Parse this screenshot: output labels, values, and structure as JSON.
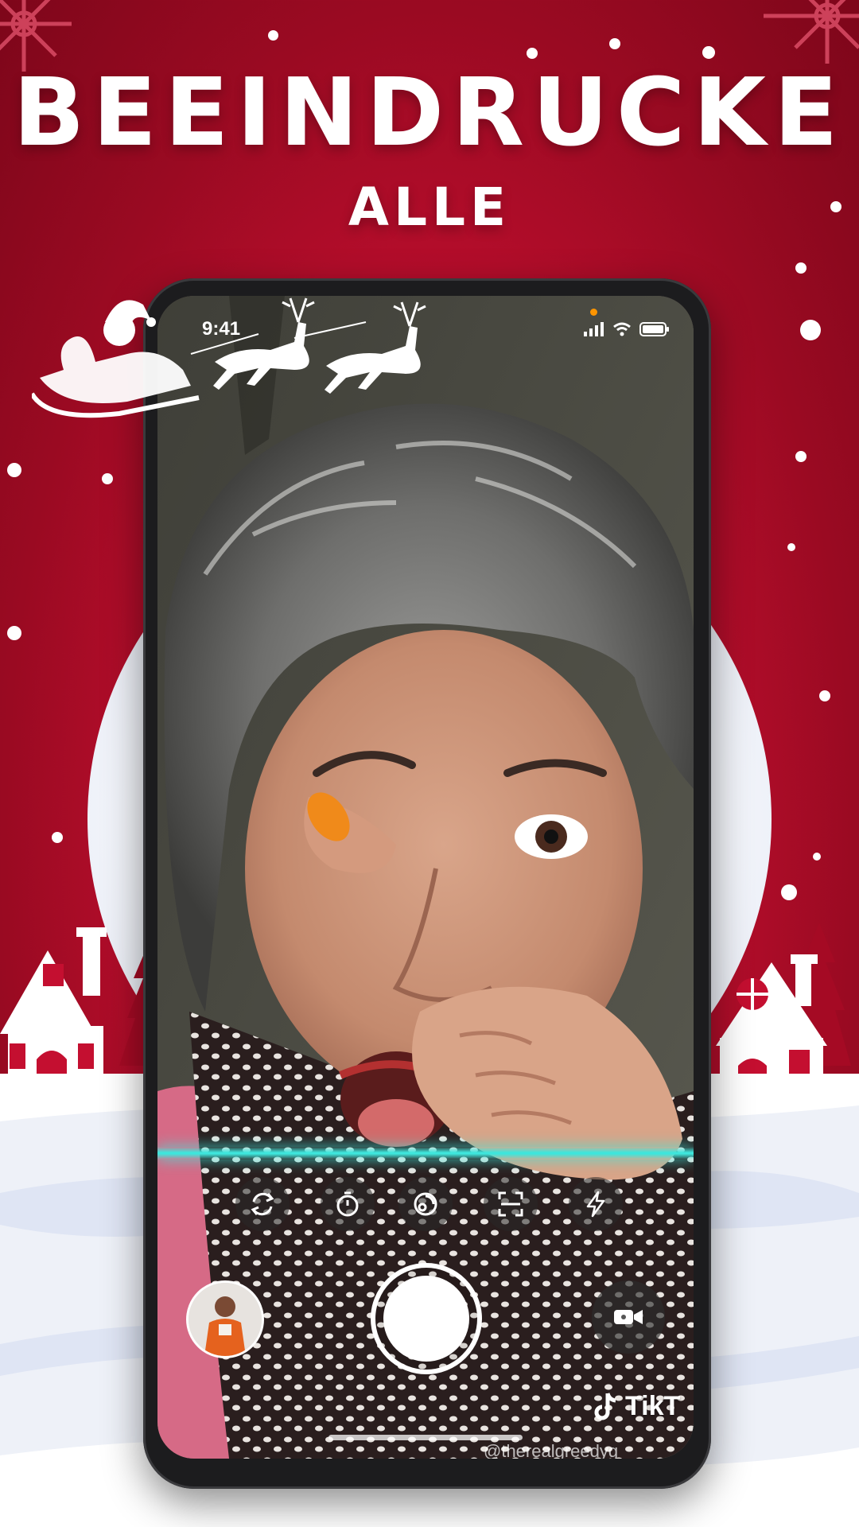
{
  "promo": {
    "headline_line1": "BEEINDRUCKE",
    "headline_line2": "ALLE",
    "background_color": "#c40f30",
    "theme": "christmas"
  },
  "status_bar": {
    "time": "9:41",
    "icons": [
      "cellular-signal-icon",
      "wifi-icon",
      "battery-icon"
    ],
    "privacy_indicator_color": "#ff9500"
  },
  "camera": {
    "tools": [
      {
        "name": "flip-camera-icon"
      },
      {
        "name": "timer-icon"
      },
      {
        "name": "filters-icon"
      },
      {
        "name": "scan-icon"
      },
      {
        "name": "flash-icon"
      }
    ],
    "scan_line_color": "#3ee6dc",
    "watermark_brand": "TikT",
    "watermark_handle": "@therealgreedyg"
  }
}
